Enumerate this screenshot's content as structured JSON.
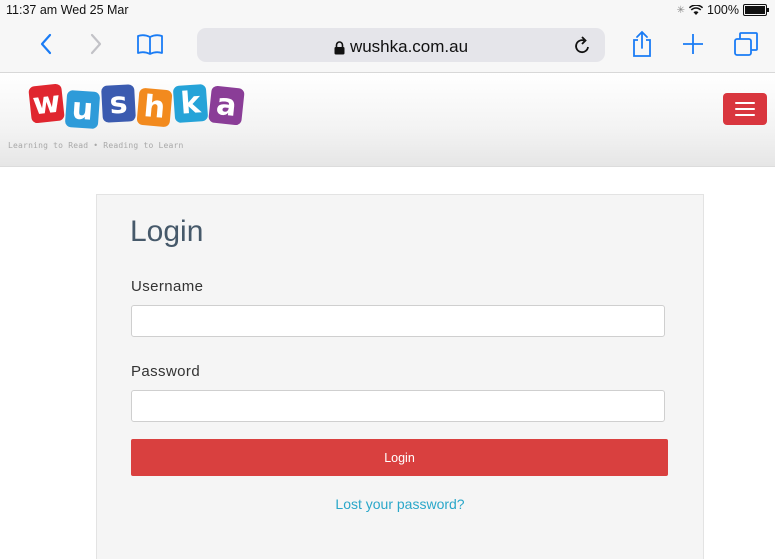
{
  "status_bar": {
    "time": "11:37 am",
    "date": "Wed 25 Mar",
    "battery": "100%"
  },
  "browser": {
    "url": "wushka.com.au",
    "icons": [
      "back-icon",
      "forward-icon",
      "bookmarks-icon",
      "lock-icon",
      "reload-icon",
      "share-icon",
      "new-tab-icon",
      "tabs-icon"
    ]
  },
  "site": {
    "logo_letters": [
      "w",
      "u",
      "s",
      "h",
      "k",
      "a"
    ],
    "logo_colors": [
      "#e0262f",
      "#2e9bd9",
      "#3b5bb0",
      "#f28a1e",
      "#25a3d8",
      "#8a3d97"
    ],
    "tagline": "Learning to Read • Reading to Learn",
    "menu_color": "#d9363e"
  },
  "login": {
    "title": "Login",
    "username_label": "Username",
    "username_value": "",
    "password_label": "Password",
    "password_value": "",
    "submit_label": "Login",
    "submit_color": "#d9403f",
    "lost_password": "Lost your password?",
    "link_color": "#2aa7c9"
  }
}
